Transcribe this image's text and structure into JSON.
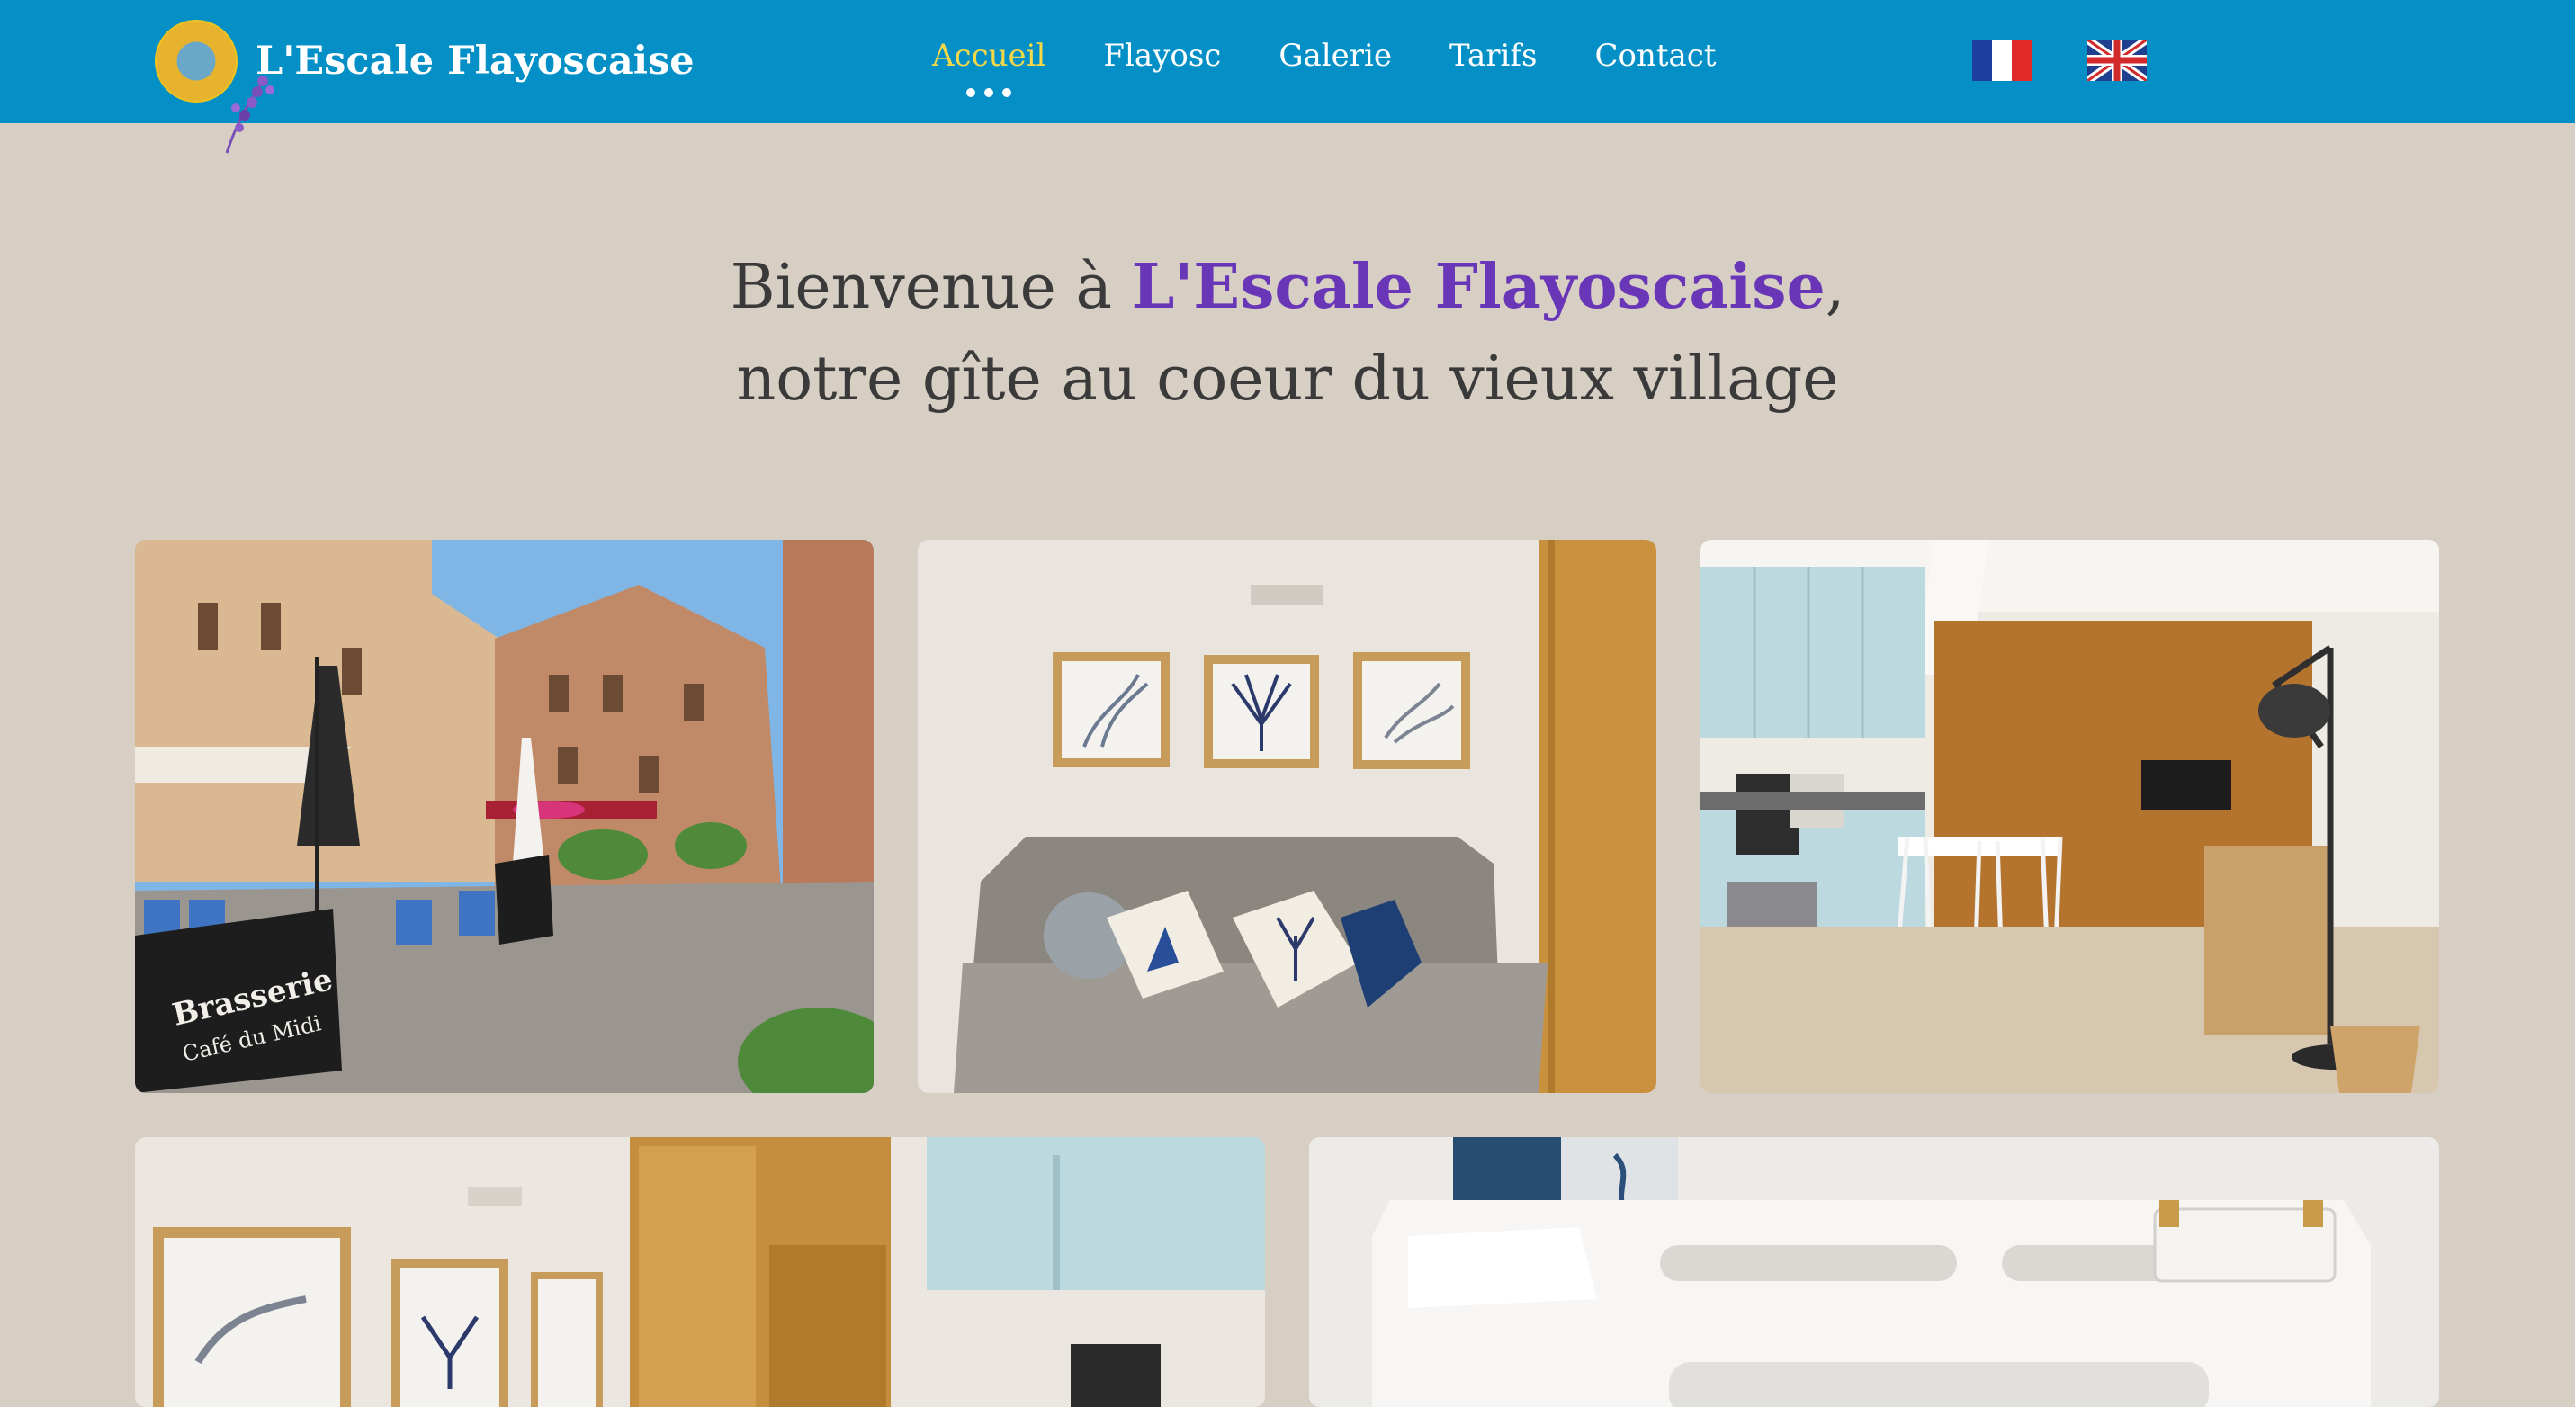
{
  "header": {
    "brand": "L'Escale Flayoscaise",
    "nav": [
      {
        "label": "Accueil",
        "active": true
      },
      {
        "label": "Flayosc",
        "active": false
      },
      {
        "label": "Galerie",
        "active": false
      },
      {
        "label": "Tarifs",
        "active": false
      },
      {
        "label": "Contact",
        "active": false
      }
    ],
    "languages": [
      "fr-flag-icon",
      "uk-flag-icon"
    ]
  },
  "hero": {
    "line1_prefix": "Bienvenue à ",
    "line1_name": "L'Escale Flayoscaise",
    "line1_suffix": ",",
    "line2": "notre gîte au coeur du vieux village"
  },
  "gallery": {
    "sign_line1": "Brasserie",
    "sign_line2": "Café du Midi"
  },
  "colors": {
    "header_bg": "#0490c6",
    "page_bg": "#d8cfc4",
    "active_nav": "#f3d84a",
    "accent": "#6a36b8"
  }
}
